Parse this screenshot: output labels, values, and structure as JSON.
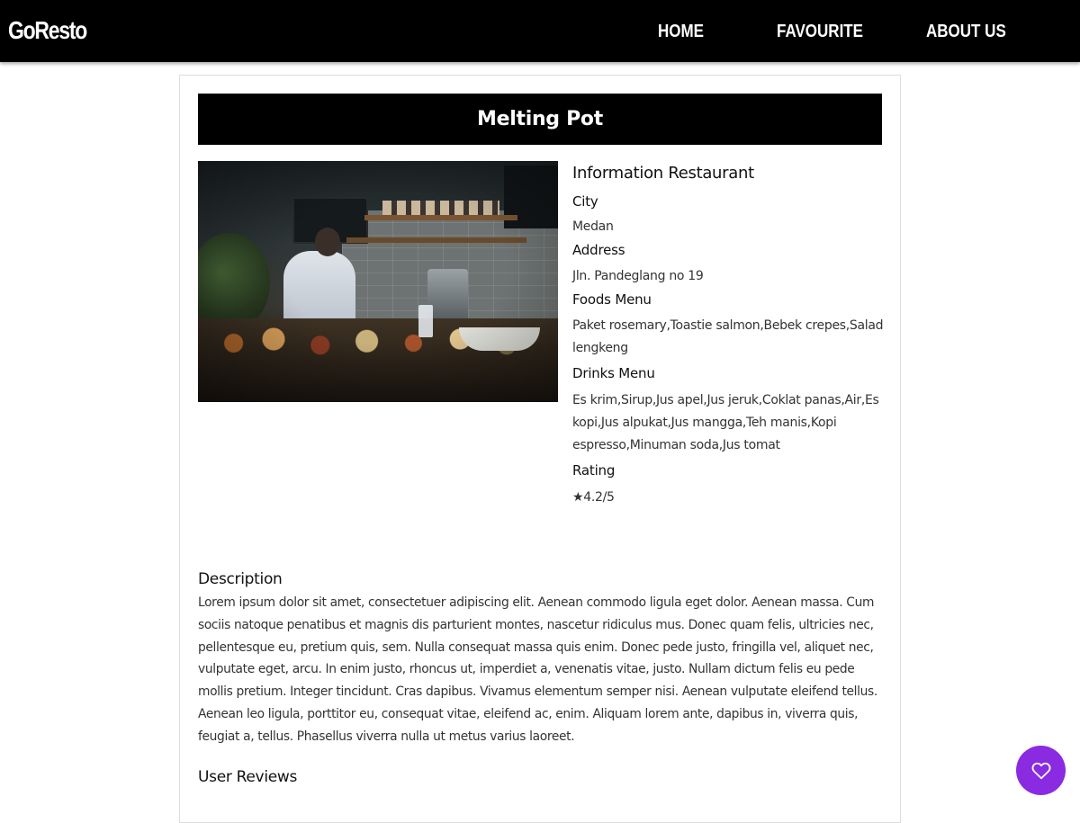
{
  "header": {
    "brand": "GoResto",
    "nav": {
      "home": "HOME",
      "favourite": "FAVOURITE",
      "about": "ABOUT US"
    },
    "background_color": "#000000"
  },
  "restaurant": {
    "name": "Melting Pot",
    "image_alt": "Melting Pot",
    "info_heading": "Information Restaurant",
    "city_label": "City",
    "city": "Medan",
    "address_label": "Address",
    "address": "Jln. Pandeglang no 19",
    "foods_label": "Foods Menu",
    "foods": "Paket rosemary,Toastie salmon,Bebek crepes,Salad lengkeng",
    "drinks_label": "Drinks Menu",
    "drinks": "Es krim,Sirup,Jus apel,Jus jeruk,Coklat panas,Air,Es kopi,Jus alpukat,Jus mangga,Teh manis,Kopi espresso,Minuman soda,Jus tomat",
    "rating_label": "Rating",
    "rating": "★4.2/5",
    "description_heading": "Description",
    "description": "Lorem ipsum dolor sit amet, consectetuer adipiscing elit. Aenean commodo ligula eget dolor. Aenean massa. Cum sociis natoque penatibus et magnis dis parturient montes, nascetur ridiculus mus. Donec quam felis, ultricies nec, pellentesque eu, pretium quis, sem. Nulla consequat massa quis enim. Donec pede justo, fringilla vel, aliquet nec, vulputate eget, arcu. In enim justo, rhoncus ut, imperdiet a, venenatis vitae, justo. Nullam dictum felis eu pede mollis pretium. Integer tincidunt. Cras dapibus. Vivamus elementum semper nisi. Aenean vulputate eleifend tellus. Aenean leo ligula, porttitor eu, consequat vitae, eleifend ac, enim. Aliquam lorem ante, dapibus in, viverra quis, feugiat a, tellus. Phasellus viverra nulla ut metus varius laoreet.",
    "reviews_heading": "User Reviews"
  },
  "favourite_button": {
    "icon": "heart-outline-icon",
    "color": "#8a2be2"
  }
}
